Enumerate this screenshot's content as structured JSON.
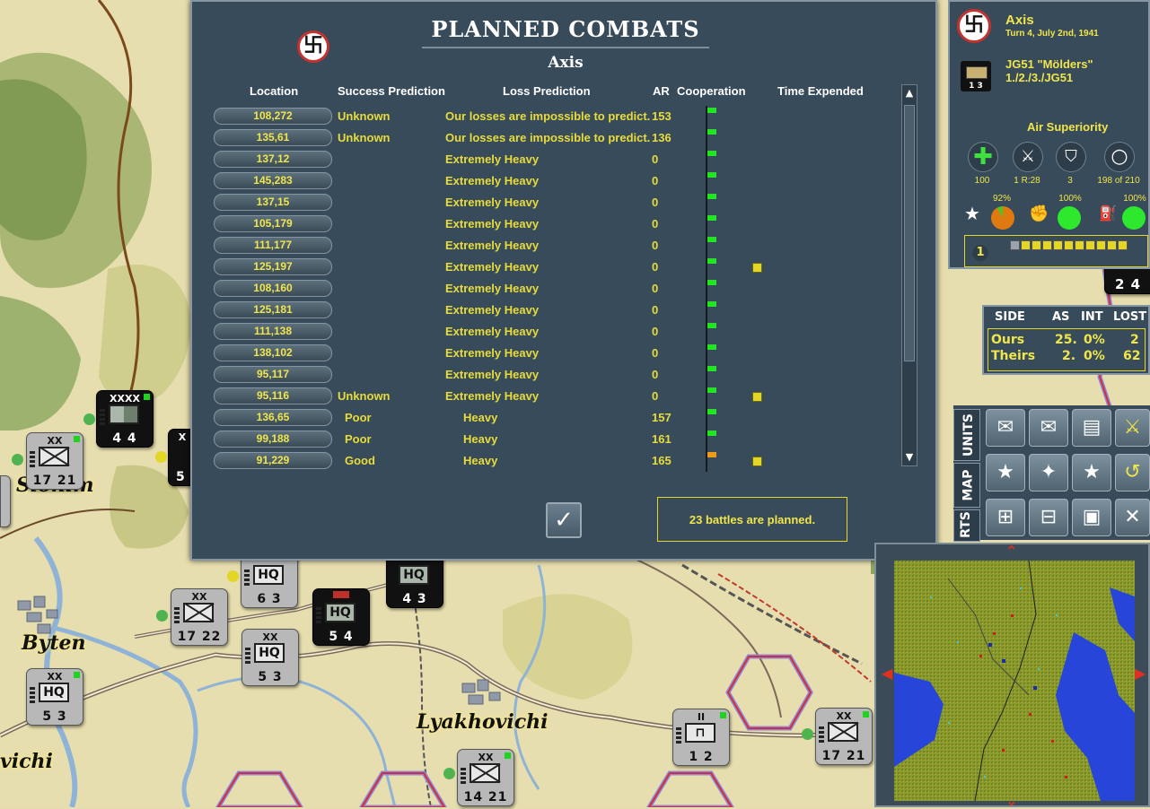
{
  "map": {
    "cities": [
      {
        "name": "Slonim",
        "id": "slonim"
      },
      {
        "name": "Byten",
        "id": "byten"
      },
      {
        "name": "Lyakhovichi",
        "id": "lyakhovichi"
      },
      {
        "name": "vichi",
        "id": "vichi"
      }
    ],
    "units": [
      {
        "id": "u1",
        "size": "XXXX",
        "type": "army",
        "strength": "4 4",
        "dark": true
      },
      {
        "id": "u2",
        "size": "XX",
        "type": "infantry",
        "strength": "17 21",
        "dark": false
      },
      {
        "id": "u3",
        "size": "X",
        "type": "army",
        "strength": "5",
        "dark": true
      },
      {
        "id": "u4",
        "size": "",
        "type": "HQ",
        "strength": "6 3",
        "dark": false
      },
      {
        "id": "u5",
        "size": "",
        "type": "HQ",
        "strength": "4 3",
        "dark": true
      },
      {
        "id": "u6",
        "size": "",
        "type": "HQ",
        "strength": "5 4",
        "dark": true
      },
      {
        "id": "u7",
        "size": "XX",
        "type": "infantry",
        "strength": "17 22",
        "dark": false
      },
      {
        "id": "u8",
        "size": "XX",
        "type": "HQ",
        "strength": "5 3",
        "dark": false
      },
      {
        "id": "u9",
        "size": "XX",
        "type": "HQ",
        "strength": "5 3",
        "dark": false
      },
      {
        "id": "u10",
        "size": "XX",
        "type": "infantry",
        "strength": "14 21",
        "dark": false
      },
      {
        "id": "u11",
        "size": "II",
        "type": "engineer",
        "strength": "1 2",
        "dark": false
      },
      {
        "id": "u12",
        "size": "XX",
        "type": "infantry",
        "strength": "17 21",
        "dark": false
      }
    ]
  },
  "dialog": {
    "title": "PLANNED COMBATS",
    "side": "Axis",
    "headers": {
      "location": "Location",
      "success": "Success Prediction",
      "loss": "Loss Prediction",
      "ar": "AR",
      "coop": "Cooperation",
      "time": "Time Expended"
    },
    "rows": [
      {
        "loc": "108,272",
        "succ": "Unknown",
        "loss": "Our losses are impossible to predict.",
        "ar": "153",
        "coop": "green",
        "time": false
      },
      {
        "loc": "135,61",
        "succ": "Unknown",
        "loss": "Our losses are impossible to predict.",
        "ar": "136",
        "coop": "green",
        "time": false
      },
      {
        "loc": "137,12",
        "succ": "",
        "loss": "Extremely Heavy",
        "ar": "0",
        "coop": "green",
        "time": false
      },
      {
        "loc": "145,283",
        "succ": "",
        "loss": "Extremely Heavy",
        "ar": "0",
        "coop": "green",
        "time": false
      },
      {
        "loc": "137,15",
        "succ": "",
        "loss": "Extremely Heavy",
        "ar": "0",
        "coop": "green",
        "time": false
      },
      {
        "loc": "105,179",
        "succ": "",
        "loss": "Extremely Heavy",
        "ar": "0",
        "coop": "green",
        "time": false
      },
      {
        "loc": "111,177",
        "succ": "",
        "loss": "Extremely Heavy",
        "ar": "0",
        "coop": "green",
        "time": false
      },
      {
        "loc": "125,197",
        "succ": "",
        "loss": "Extremely Heavy",
        "ar": "0",
        "coop": "green",
        "time": true
      },
      {
        "loc": "108,160",
        "succ": "",
        "loss": "Extremely Heavy",
        "ar": "0",
        "coop": "green",
        "time": false
      },
      {
        "loc": "125,181",
        "succ": "",
        "loss": "Extremely Heavy",
        "ar": "0",
        "coop": "green",
        "time": false
      },
      {
        "loc": "111,138",
        "succ": "",
        "loss": "Extremely Heavy",
        "ar": "0",
        "coop": "green",
        "time": false
      },
      {
        "loc": "138,102",
        "succ": "",
        "loss": "Extremely Heavy",
        "ar": "0",
        "coop": "green",
        "time": false
      },
      {
        "loc": "95,117",
        "succ": "",
        "loss": "Extremely Heavy",
        "ar": "0",
        "coop": "green",
        "time": false
      },
      {
        "loc": "95,116",
        "succ": "Unknown",
        "loss": "Extremely Heavy",
        "ar": "0",
        "coop": "green",
        "time": true
      },
      {
        "loc": "136,65",
        "succ": "Poor",
        "loss": "Heavy",
        "ar": "157",
        "coop": "green",
        "time": false
      },
      {
        "loc": "99,188",
        "succ": "Poor",
        "loss": "Heavy",
        "ar": "161",
        "coop": "green",
        "time": false
      },
      {
        "loc": "91,229",
        "succ": "Good",
        "loss": "Heavy",
        "ar": "165",
        "coop": "orange",
        "time": true
      }
    ],
    "ok_icon": "checkmark-icon",
    "status": "23 battles are planned."
  },
  "panel": {
    "side": "Axis",
    "turn": "Turn 4, July 2nd, 1941",
    "unit_name": "JG51 \"Mölders\"",
    "unit_sub": "1./2./3./JG51",
    "unit_strength": "1 3",
    "air_superiority": "Air Superiority",
    "stats": [
      {
        "icon": "plus-icon",
        "value": "100"
      },
      {
        "icon": "crossed-swords-icon",
        "value": "1 R:28"
      },
      {
        "icon": "shield-icon",
        "value": "3"
      },
      {
        "icon": "circle-icon",
        "value": "198 of 210"
      }
    ],
    "gauges": [
      {
        "icon": "star-icon",
        "value": "92%"
      },
      {
        "icon": "fist-icon",
        "value": "100%"
      },
      {
        "icon": "fuel-icon",
        "value": "100%"
      }
    ],
    "strip_num": "1",
    "strip_squares": 11
  },
  "battle_stats": {
    "headers": [
      "SIDE",
      "AS",
      "INT",
      "LOST"
    ],
    "rows": [
      {
        "side": "Ours",
        "as": "25.",
        "int": "0%",
        "lost": "2"
      },
      {
        "side": "Theirs",
        "as": "2.",
        "int": "0%",
        "lost": "62"
      }
    ]
  },
  "tabs": [
    "UNITS",
    "MAP",
    "RTS"
  ],
  "counter_top_right": "2 4",
  "colors": {
    "panel": "#384b5a",
    "accent": "#f0e64a",
    "coop_green": "#25e325",
    "coop_orange": "#f09a1c"
  }
}
